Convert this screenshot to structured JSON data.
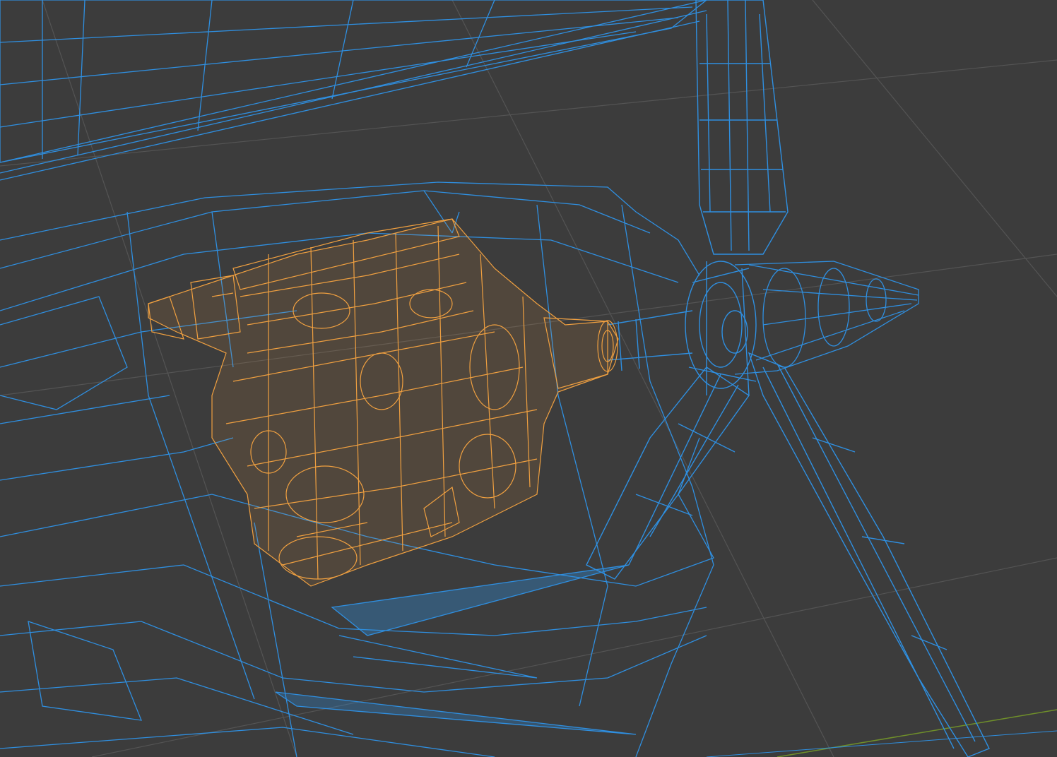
{
  "viewport": {
    "mode": "wireframe",
    "background_color": "#3c3c3c",
    "grid_color": "#595959",
    "axis_x_color": "#9a3a3a",
    "axis_y_color": "#6f8f2a"
  },
  "objects": [
    {
      "name": "aircraft-airframe",
      "state": "unselected",
      "wire_color": "#2f8fe0"
    },
    {
      "name": "propeller",
      "state": "unselected",
      "wire_color": "#2f8fe0"
    },
    {
      "name": "spinner",
      "state": "unselected",
      "wire_color": "#2f8fe0"
    },
    {
      "name": "engine",
      "state": "selected",
      "wire_color": "#f0a040"
    }
  ]
}
